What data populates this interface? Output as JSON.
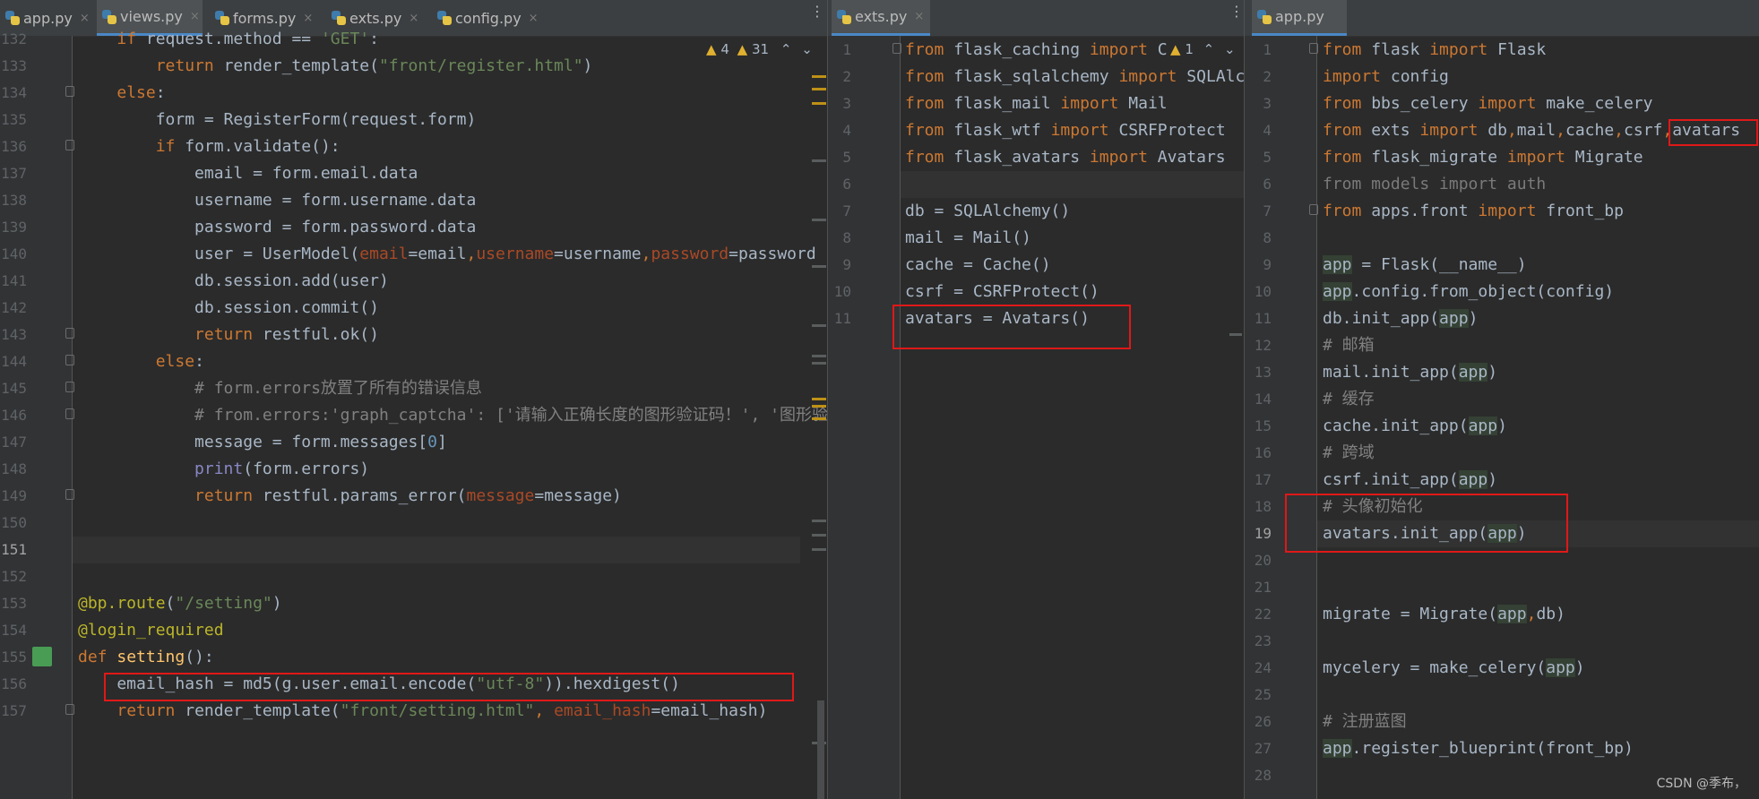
{
  "colors": {
    "background": "#2b2b2b",
    "keyword": "#cc7832",
    "string": "#6a8759",
    "comment": "#808080",
    "number": "#6897bb",
    "decorator": "#bbb529",
    "function": "#ffc66d",
    "param": "#aa4926",
    "highlight_box": "#e01818"
  },
  "pane1": {
    "tabs": [
      {
        "label": "app.py",
        "icon": "python-file-icon"
      },
      {
        "label": "views.py",
        "icon": "python-file-icon",
        "active": true
      },
      {
        "label": "forms.py",
        "icon": "python-file-icon"
      },
      {
        "label": "exts.py",
        "icon": "python-file-icon"
      },
      {
        "label": "config.py",
        "icon": "python-file-icon"
      }
    ],
    "close_glyph": "×",
    "more_glyph": "⋮",
    "inspection": {
      "warnings": "4",
      "weak_warnings": "31"
    },
    "line_numbers": [
      "132",
      "133",
      "134",
      "135",
      "136",
      "137",
      "138",
      "139",
      "140",
      "141",
      "142",
      "143",
      "144",
      "145",
      "146",
      "147",
      "148",
      "149",
      "150",
      "151",
      "152",
      "153",
      "154",
      "155",
      "156",
      "157"
    ],
    "lines": [
      "    if request.method == 'GET':",
      "        return render_template(\"front/register.html\")",
      "    else:",
      "        form = RegisterForm(request.form)",
      "        if form.validate():",
      "            email = form.email.data",
      "            username = form.username.data",
      "            password = form.password.data",
      "            user = UserModel(email=email,username=username,password=password",
      "            db.session.add(user)",
      "            db.session.commit()",
      "            return restful.ok()",
      "        else:",
      "            # form.errors放置了所有的错误信息",
      "            # from.errors:'graph_captcha': ['请输入正确长度的图形验证码！', '图形验",
      "            message = form.messages[0]",
      "            print(form.errors)",
      "            return restful.params_error(message=message)",
      "",
      "",
      "",
      "@bp.route(\"/setting\")",
      "@login_required",
      "def setting():",
      "    email_hash = md5(g.user.email.encode(\"utf-8\")).hexdigest()",
      "    return render_template(\"front/setting.html\", email_hash=email_hash)"
    ]
  },
  "pane2": {
    "tabs": [
      {
        "label": "exts.py",
        "icon": "python-file-icon",
        "active": true
      }
    ],
    "close_glyph": "×",
    "more_glyph": "⋮",
    "inspection": {
      "warnings": "1"
    },
    "line_numbers": [
      "1",
      "2",
      "3",
      "4",
      "5",
      "6",
      "7",
      "8",
      "9",
      "10",
      "11"
    ],
    "lines": [
      "from flask_caching import Cache",
      "from flask_sqlalchemy import SQLAlchemy",
      "from flask_mail import Mail",
      "from flask_wtf import CSRFProtect",
      "from flask_avatars import Avatars",
      "",
      "db = SQLAlchemy()",
      "mail = Mail()",
      "cache = Cache()",
      "csrf = CSRFProtect()",
      "avatars = Avatars()"
    ]
  },
  "pane3": {
    "tabs": [
      {
        "label": "app.py",
        "icon": "python-file-icon",
        "active": true
      }
    ],
    "line_numbers": [
      "1",
      "2",
      "3",
      "4",
      "5",
      "6",
      "7",
      "8",
      "9",
      "10",
      "11",
      "12",
      "13",
      "14",
      "15",
      "16",
      "17",
      "18",
      "19",
      "20",
      "21",
      "22",
      "23",
      "24",
      "25",
      "26",
      "27",
      "28"
    ],
    "lines": [
      "from flask import Flask",
      "import config",
      "from bbs_celery import make_celery",
      "from exts import db,mail,cache,csrf,avatars",
      "from flask_migrate import Migrate",
      "from models import auth",
      "from apps.front import front_bp",
      "",
      "app = Flask(__name__)",
      "app.config.from_object(config)",
      "db.init_app(app)",
      "# 邮箱",
      "mail.init_app(app)",
      "# 缓存",
      "cache.init_app(app)",
      "# 跨域",
      "csrf.init_app(app)",
      "# 头像初始化",
      "avatars.init_app(app)",
      "",
      "",
      "migrate = Migrate(app,db)",
      "",
      "mycelery = make_celery(app)",
      "",
      "# 注册蓝图",
      "app.register_blueprint(front_bp)",
      ""
    ]
  },
  "watermark": "CSDN @季布，"
}
